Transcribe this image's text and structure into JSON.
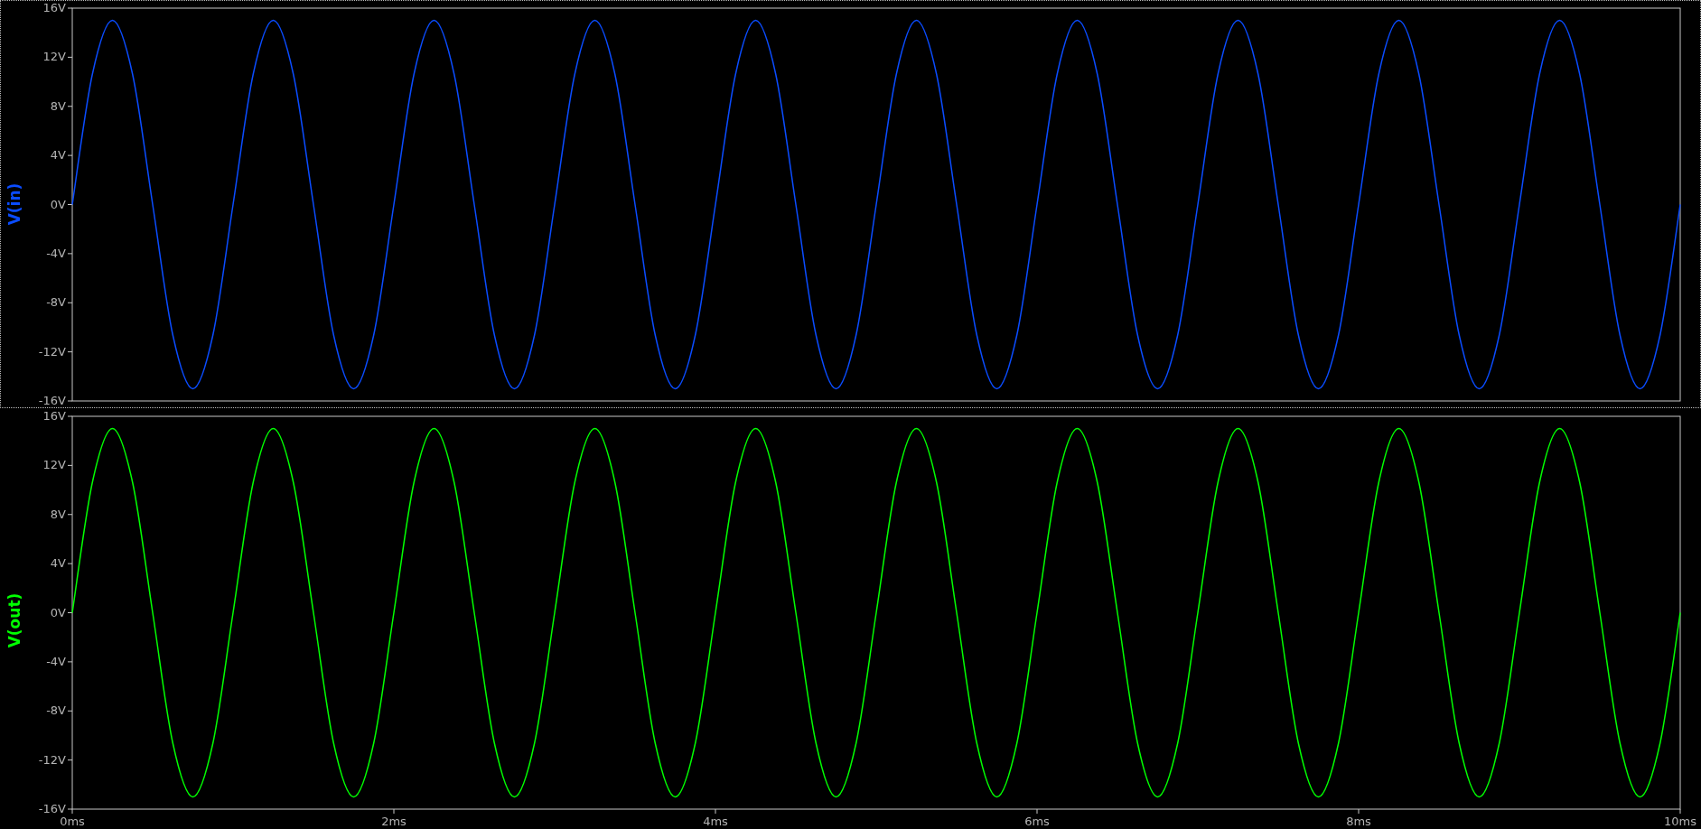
{
  "panes": [
    {
      "selected": true,
      "chart_data": {
        "type": "line",
        "xlim": [
          0,
          10
        ],
        "ylim": [
          -16,
          16
        ],
        "yticks": [
          {
            "value": 16,
            "label": "16V"
          },
          {
            "value": 12,
            "label": "12V"
          },
          {
            "value": 8,
            "label": "8V"
          },
          {
            "value": 4,
            "label": "4V"
          },
          {
            "value": 0,
            "label": "0V"
          },
          {
            "value": -4,
            "label": "-4V"
          },
          {
            "value": -8,
            "label": "-8V"
          },
          {
            "value": -12,
            "label": "-12V"
          },
          {
            "value": -16,
            "label": "-16V"
          }
        ],
        "x": [
          0,
          0.125,
          0.25,
          0.375,
          0.5,
          0.625,
          0.75,
          0.875,
          1,
          1.125,
          1.25,
          1.375,
          1.5,
          1.625,
          1.75,
          1.875,
          2,
          2.125,
          2.25,
          2.375,
          2.5,
          2.625,
          2.75,
          2.875,
          3,
          3.125,
          3.25,
          3.375,
          3.5,
          3.625,
          3.75,
          3.875,
          4,
          4.125,
          4.25,
          4.375,
          4.5,
          4.625,
          4.75,
          4.875,
          5,
          5.125,
          5.25,
          5.375,
          5.5,
          5.625,
          5.75,
          5.875,
          6,
          6.125,
          6.25,
          6.375,
          6.5,
          6.625,
          6.75,
          6.875,
          7,
          7.125,
          7.25,
          7.375,
          7.5,
          7.625,
          7.75,
          7.875,
          8,
          8.125,
          8.25,
          8.375,
          8.5,
          8.625,
          8.75,
          8.875,
          9,
          9.125,
          9.25,
          9.375,
          9.5,
          9.625,
          9.75,
          9.875,
          10
        ],
        "series": [
          {
            "name": "V(in)",
            "color": "#0a4cff",
            "values": [
              0,
              10.61,
              15,
              10.61,
              0,
              -10.61,
              -15,
              -10.61,
              0,
              10.61,
              15,
              10.61,
              0,
              -10.61,
              -15,
              -10.61,
              0,
              10.61,
              15,
              10.61,
              0,
              -10.61,
              -15,
              -10.61,
              0,
              10.61,
              15,
              10.61,
              0,
              -10.61,
              -15,
              -10.61,
              0,
              10.61,
              15,
              10.61,
              0,
              -10.61,
              -15,
              -10.61,
              0,
              10.61,
              15,
              10.61,
              0,
              -10.61,
              -15,
              -10.61,
              0,
              10.61,
              15,
              10.61,
              0,
              -10.61,
              -15,
              -10.61,
              0,
              10.61,
              15,
              10.61,
              0,
              -10.61,
              -15,
              -10.61,
              0,
              10.61,
              15,
              10.61,
              0,
              -10.61,
              -15,
              -10.61,
              0,
              10.61,
              15,
              10.61,
              0,
              -10.61,
              -15,
              -10.61,
              0
            ]
          }
        ]
      }
    },
    {
      "selected": false,
      "chart_data": {
        "type": "line",
        "xlim": [
          0,
          10
        ],
        "ylim": [
          -16,
          16
        ],
        "xticks": [
          {
            "value": 0,
            "label": "0ms"
          },
          {
            "value": 2,
            "label": "2ms"
          },
          {
            "value": 4,
            "label": "4ms"
          },
          {
            "value": 6,
            "label": "6ms"
          },
          {
            "value": 8,
            "label": "8ms"
          },
          {
            "value": 10,
            "label": "10ms"
          }
        ],
        "yticks": [
          {
            "value": 16,
            "label": "16V"
          },
          {
            "value": 12,
            "label": "12V"
          },
          {
            "value": 8,
            "label": "8V"
          },
          {
            "value": 4,
            "label": "4V"
          },
          {
            "value": 0,
            "label": "0V"
          },
          {
            "value": -4,
            "label": "-4V"
          },
          {
            "value": -8,
            "label": "-8V"
          },
          {
            "value": -12,
            "label": "-12V"
          },
          {
            "value": -16,
            "label": "-16V"
          }
        ],
        "x": [
          0,
          0.125,
          0.25,
          0.375,
          0.5,
          0.625,
          0.75,
          0.875,
          1,
          1.125,
          1.25,
          1.375,
          1.5,
          1.625,
          1.75,
          1.875,
          2,
          2.125,
          2.25,
          2.375,
          2.5,
          2.625,
          2.75,
          2.875,
          3,
          3.125,
          3.25,
          3.375,
          3.5,
          3.625,
          3.75,
          3.875,
          4,
          4.125,
          4.25,
          4.375,
          4.5,
          4.625,
          4.75,
          4.875,
          5,
          5.125,
          5.25,
          5.375,
          5.5,
          5.625,
          5.75,
          5.875,
          6,
          6.125,
          6.25,
          6.375,
          6.5,
          6.625,
          6.75,
          6.875,
          7,
          7.125,
          7.25,
          7.375,
          7.5,
          7.625,
          7.75,
          7.875,
          8,
          8.125,
          8.25,
          8.375,
          8.5,
          8.625,
          8.75,
          8.875,
          9,
          9.125,
          9.25,
          9.375,
          9.5,
          9.625,
          9.75,
          9.875,
          10
        ],
        "series": [
          {
            "name": "V(out)",
            "color": "#00ff00",
            "values": [
              0,
              10.61,
              15,
              10.61,
              0,
              -10.61,
              -15,
              -10.61,
              0,
              10.61,
              15,
              10.61,
              0,
              -10.61,
              -15,
              -10.61,
              0,
              10.61,
              15,
              10.61,
              0,
              -10.61,
              -15,
              -10.61,
              0,
              10.61,
              15,
              10.61,
              0,
              -10.61,
              -15,
              -10.61,
              0,
              10.61,
              15,
              10.61,
              0,
              -10.61,
              -15,
              -10.61,
              0,
              10.61,
              15,
              10.61,
              0,
              -10.61,
              -15,
              -10.61,
              0,
              10.61,
              15,
              10.61,
              0,
              -10.61,
              -15,
              -10.61,
              0,
              10.61,
              15,
              10.61,
              0,
              -10.61,
              -15,
              -10.61,
              0,
              10.61,
              15,
              10.61,
              0,
              -10.61,
              -15,
              -10.61,
              0,
              10.61,
              15,
              10.61,
              0,
              -10.61,
              -15,
              -10.61,
              0
            ]
          }
        ]
      }
    }
  ]
}
